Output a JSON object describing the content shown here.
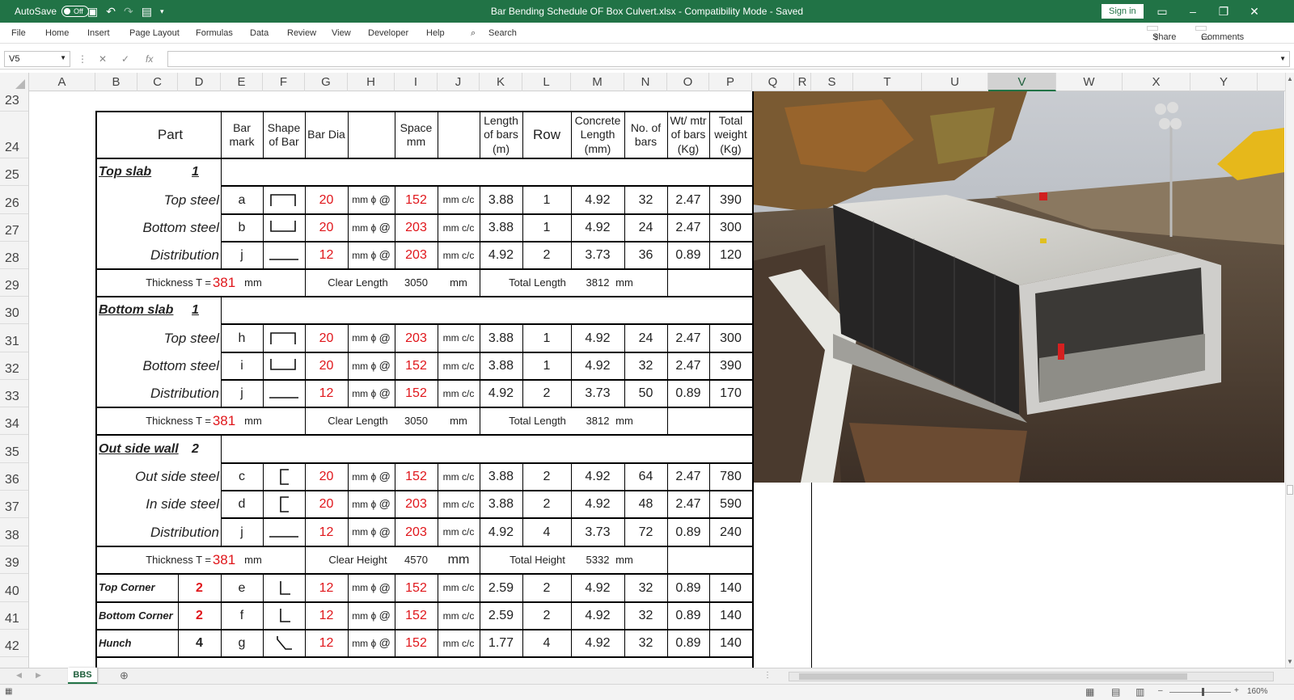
{
  "titlebar": {
    "autosave_label": "AutoSave",
    "autosave_state": "Off",
    "title": "Bar Bending Schedule OF Box Culvert.xlsx  -  Compatibility Mode  -  Saved",
    "signin": "Sign in"
  },
  "menu": {
    "items": [
      "File",
      "Home",
      "Insert",
      "Page Layout",
      "Formulas",
      "Data",
      "Review",
      "View",
      "Developer",
      "Help"
    ],
    "search": "Search",
    "share": "Share",
    "comments": "Comments"
  },
  "formula_bar": {
    "name_box": "V5",
    "fx": "fx",
    "value": ""
  },
  "columns": [
    "A",
    "B",
    "C",
    "D",
    "E",
    "F",
    "G",
    "H",
    "I",
    "J",
    "K",
    "L",
    "M",
    "N",
    "O",
    "P",
    "Q",
    "R",
    "S",
    "T",
    "U",
    "V",
    "W",
    "X",
    "Y"
  ],
  "selected_column": "V",
  "rows": [
    "23",
    "24",
    "25",
    "26",
    "27",
    "28",
    "29",
    "30",
    "31",
    "32",
    "33",
    "34",
    "35",
    "36",
    "37",
    "38",
    "39",
    "40",
    "41",
    "42"
  ],
  "header": {
    "part": "Part",
    "bar_mark": "Bar mark",
    "shape": "Shape of Bar",
    "bar_dia": "Bar Dia",
    "space": "Space mm",
    "length": "Length of bars (m)",
    "row": "Row",
    "concrete": "Concrete Length (mm)",
    "nos": "No. of bars",
    "wt": "Wt/ mtr of bars (Kg)",
    "total": "Total weight (Kg)"
  },
  "units": {
    "mm_phi": "mm ϕ",
    "at": "@",
    "mm_cc": "mm c/c",
    "mm": "mm"
  },
  "sections": [
    {
      "title": "Top slab",
      "count": "1",
      "rows": [
        {
          "label": "Top steel",
          "mark": "a",
          "dia": "20",
          "space": "152",
          "len": "3.88",
          "row": "1",
          "conc": "4.92",
          "nos": "32",
          "wt": "2.47",
          "total": "390"
        },
        {
          "label": "Bottom steel",
          "mark": "b",
          "dia": "20",
          "space": "203",
          "len": "3.88",
          "row": "1",
          "conc": "4.92",
          "nos": "24",
          "wt": "2.47",
          "total": "300"
        },
        {
          "label": "Distribution",
          "mark": "j",
          "dia": "12",
          "space": "203",
          "len": "4.92",
          "row": "2",
          "conc": "3.73",
          "nos": "36",
          "wt": "0.89",
          "total": "120"
        }
      ],
      "thickness_label": "Thickness T =",
      "thickness": "381",
      "clear_label": "Clear Length",
      "clear": "3050",
      "total_label": "Total Length",
      "total_len": "3812"
    },
    {
      "title": "Bottom slab",
      "count": "1",
      "rows": [
        {
          "label": "Top steel",
          "mark": "h",
          "dia": "20",
          "space": "203",
          "len": "3.88",
          "row": "1",
          "conc": "4.92",
          "nos": "24",
          "wt": "2.47",
          "total": "300"
        },
        {
          "label": "Bottom steel",
          "mark": "i",
          "dia": "20",
          "space": "152",
          "len": "3.88",
          "row": "1",
          "conc": "4.92",
          "nos": "32",
          "wt": "2.47",
          "total": "390"
        },
        {
          "label": "Distribution",
          "mark": "j",
          "dia": "12",
          "space": "152",
          "len": "4.92",
          "row": "2",
          "conc": "3.73",
          "nos": "50",
          "wt": "0.89",
          "total": "170"
        }
      ],
      "thickness_label": "Thickness T =",
      "thickness": "381",
      "clear_label": "Clear Length",
      "clear": "3050",
      "total_label": "Total Length",
      "total_len": "3812"
    },
    {
      "title": "Out side wall",
      "count": "2",
      "rows": [
        {
          "label": "Out side steel",
          "mark": "c",
          "dia": "20",
          "space": "152",
          "len": "3.88",
          "row": "2",
          "conc": "4.92",
          "nos": "64",
          "wt": "2.47",
          "total": "780"
        },
        {
          "label": "In side steel",
          "mark": "d",
          "dia": "20",
          "space": "203",
          "len": "3.88",
          "row": "2",
          "conc": "4.92",
          "nos": "48",
          "wt": "2.47",
          "total": "590"
        },
        {
          "label": "Distribution",
          "mark": "j",
          "dia": "12",
          "space": "203",
          "len": "4.92",
          "row": "4",
          "conc": "3.73",
          "nos": "72",
          "wt": "0.89",
          "total": "240"
        }
      ],
      "thickness_label": "Thickness T =",
      "thickness": "381",
      "clear_label": "Clear Height",
      "clear": "4570",
      "total_label": "Total Height",
      "total_len": "5332"
    }
  ],
  "corners": [
    {
      "label": "Top Corner",
      "count": "2",
      "mark": "e",
      "dia": "12",
      "space": "152",
      "len": "2.59",
      "row": "2",
      "conc": "4.92",
      "nos": "32",
      "wt": "0.89",
      "total": "140"
    },
    {
      "label": "Bottom Corner",
      "count": "2",
      "mark": "f",
      "dia": "12",
      "space": "152",
      "len": "2.59",
      "row": "2",
      "conc": "4.92",
      "nos": "32",
      "wt": "0.89",
      "total": "140"
    },
    {
      "label": "Hunch",
      "count": "4",
      "mark": "g",
      "dia": "12",
      "space": "152",
      "len": "1.77",
      "row": "4",
      "conc": "4.92",
      "nos": "32",
      "wt": "0.89",
      "total": "140"
    }
  ],
  "sheet_tab": "BBS",
  "zoom": "160%",
  "colors": {
    "accent": "#217346",
    "value_red": "#e0161b"
  }
}
